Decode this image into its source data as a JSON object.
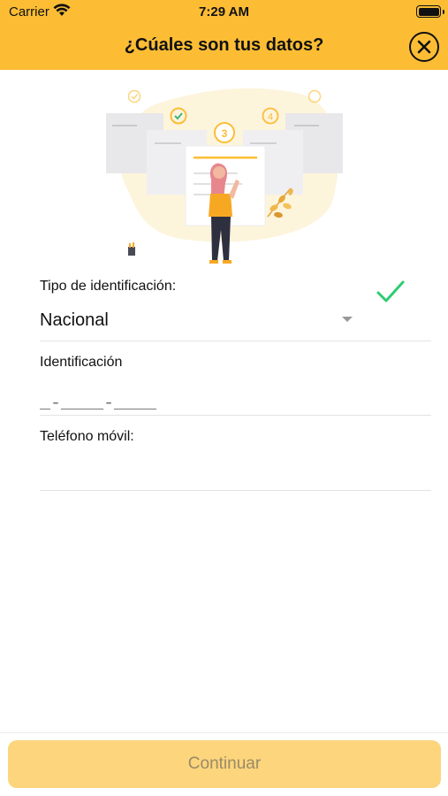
{
  "status_bar": {
    "carrier": "Carrier",
    "time": "7:29 AM"
  },
  "nav": {
    "title": "¿Cúales son tus datos?"
  },
  "illustration": {
    "step_labels": [
      "3",
      "4"
    ]
  },
  "form": {
    "id_type": {
      "label": "Tipo de identificación:",
      "value": "Nacional"
    },
    "identification": {
      "label": "Identificación",
      "mask": "_-____-____"
    },
    "phone": {
      "label": "Teléfono móvil:",
      "value": ""
    }
  },
  "footer": {
    "continue_label": "Continuar"
  },
  "colors": {
    "brand": "#fcbd35",
    "button_disabled": "#fcd57d",
    "check": "#2ecc71"
  }
}
